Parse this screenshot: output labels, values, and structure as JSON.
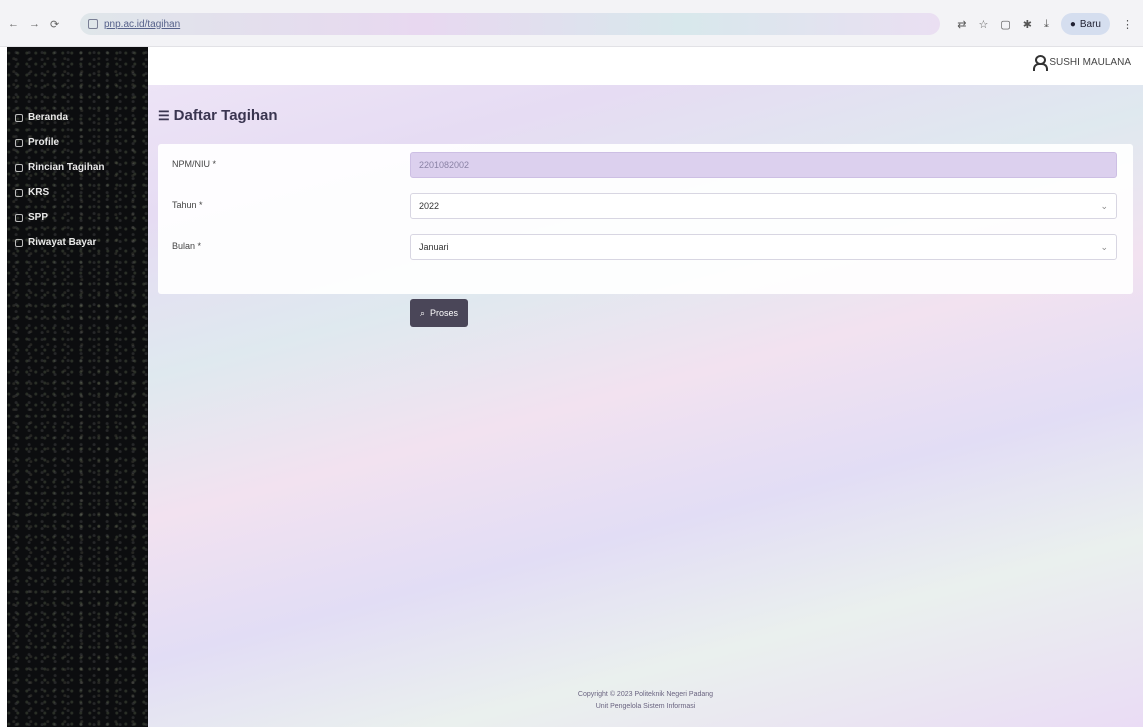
{
  "browser": {
    "url": "pnp.ac.id/tagihan",
    "profile_button": "Baru"
  },
  "sidebar": {
    "items": [
      {
        "label": "Beranda",
        "icon": "home-icon"
      },
      {
        "label": "Profile",
        "icon": "user-icon"
      },
      {
        "label": "Rincian Tagihan",
        "icon": "list-icon"
      },
      {
        "label": "KRS",
        "icon": "document-icon"
      },
      {
        "label": "SPP",
        "icon": "wallet-icon"
      },
      {
        "label": "Riwayat Bayar",
        "icon": "history-icon"
      }
    ]
  },
  "header": {
    "user_name": "SUSHI MAULANA"
  },
  "page": {
    "title": "Daftar Tagihan",
    "title_icon": "list-icon"
  },
  "form": {
    "fields": [
      {
        "label": "NPM/NIU *",
        "value": "2201082002",
        "type": "readonly"
      },
      {
        "label": "Tahun *",
        "value": "2022",
        "type": "select"
      },
      {
        "label": "Bulan *",
        "value": "Januari",
        "type": "select"
      }
    ],
    "submit_label": "Proses",
    "submit_icon": "search-icon"
  },
  "footer": {
    "line1": "Copyright © 2023 Politeknik Negeri Padang",
    "line2": "Unit Pengelola Sistem Informasi"
  },
  "colors": {
    "sidebar_bg": "#0c0d0f",
    "button_bg": "#4a4658",
    "readonly_field_bg": "#dcd0ee"
  }
}
